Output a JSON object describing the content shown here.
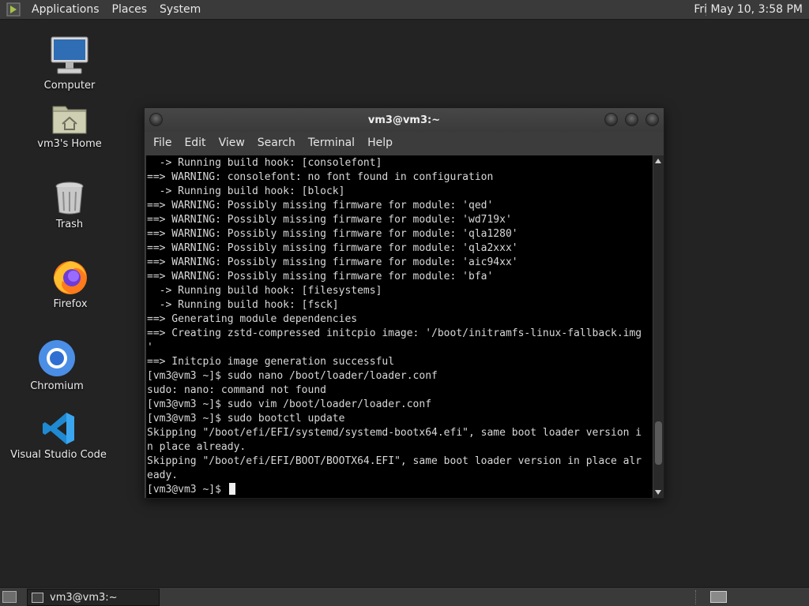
{
  "top_panel": {
    "menus": [
      "Applications",
      "Places",
      "System"
    ],
    "clock": "Fri May 10,  3:58 PM"
  },
  "desktop_icons": [
    {
      "label": "Computer",
      "icon": "computer-icon"
    },
    {
      "label": "vm3's Home",
      "icon": "home-folder-icon"
    },
    {
      "label": "Trash",
      "icon": "trash-icon"
    },
    {
      "label": "Firefox",
      "icon": "firefox-icon"
    },
    {
      "label": "Chromium",
      "icon": "chromium-icon"
    },
    {
      "label": "Visual Studio Code",
      "icon": "vscode-icon"
    }
  ],
  "terminal": {
    "title": "vm3@vm3:~",
    "menu": [
      "File",
      "Edit",
      "View",
      "Search",
      "Terminal",
      "Help"
    ],
    "lines": [
      "  -> Running build hook: [consolefont]",
      "==> WARNING: consolefont: no font found in configuration",
      "  -> Running build hook: [block]",
      "==> WARNING: Possibly missing firmware for module: 'qed'",
      "==> WARNING: Possibly missing firmware for module: 'wd719x'",
      "==> WARNING: Possibly missing firmware for module: 'qla1280'",
      "==> WARNING: Possibly missing firmware for module: 'qla2xxx'",
      "==> WARNING: Possibly missing firmware for module: 'aic94xx'",
      "==> WARNING: Possibly missing firmware for module: 'bfa'",
      "  -> Running build hook: [filesystems]",
      "  -> Running build hook: [fsck]",
      "==> Generating module dependencies",
      "==> Creating zstd-compressed initcpio image: '/boot/initramfs-linux-fallback.img",
      "'",
      "==> Initcpio image generation successful",
      "[vm3@vm3 ~]$ sudo nano /boot/loader/loader.conf",
      "sudo: nano: command not found",
      "[vm3@vm3 ~]$ sudo vim /boot/loader/loader.conf",
      "[vm3@vm3 ~]$ sudo bootctl update",
      "Skipping \"/boot/efi/EFI/systemd/systemd-bootx64.efi\", same boot loader version i",
      "n place already.",
      "Skipping \"/boot/efi/EFI/BOOT/BOOTX64.EFI\", same boot loader version in place alr",
      "eady."
    ],
    "prompt": "[vm3@vm3 ~]$ ",
    "scroll_position": 0.92
  },
  "taskbar": {
    "window_label": "vm3@vm3:~"
  }
}
